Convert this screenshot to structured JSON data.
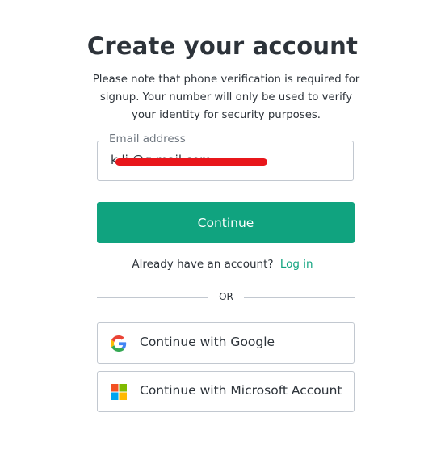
{
  "header": {
    "title": "Create your account",
    "subtitle": "Please note that phone verification is required for signup. Your number will only be used to verify your identity for security purposes."
  },
  "email": {
    "label": "Email address",
    "value": "k     li          @g mail.com"
  },
  "continue_button": {
    "label": "Continue"
  },
  "login_prompt": {
    "text": "Already have an account?",
    "link_label": "Log in"
  },
  "divider": {
    "label": "OR"
  },
  "social": [
    {
      "label": "Continue with Google",
      "icon": "google-icon"
    },
    {
      "label": "Continue with Microsoft Account",
      "icon": "microsoft-icon"
    }
  ],
  "colors": {
    "accent": "#10a37f",
    "text": "#2d333a",
    "border": "#c2c8d0",
    "redaction": "#e8161b"
  }
}
